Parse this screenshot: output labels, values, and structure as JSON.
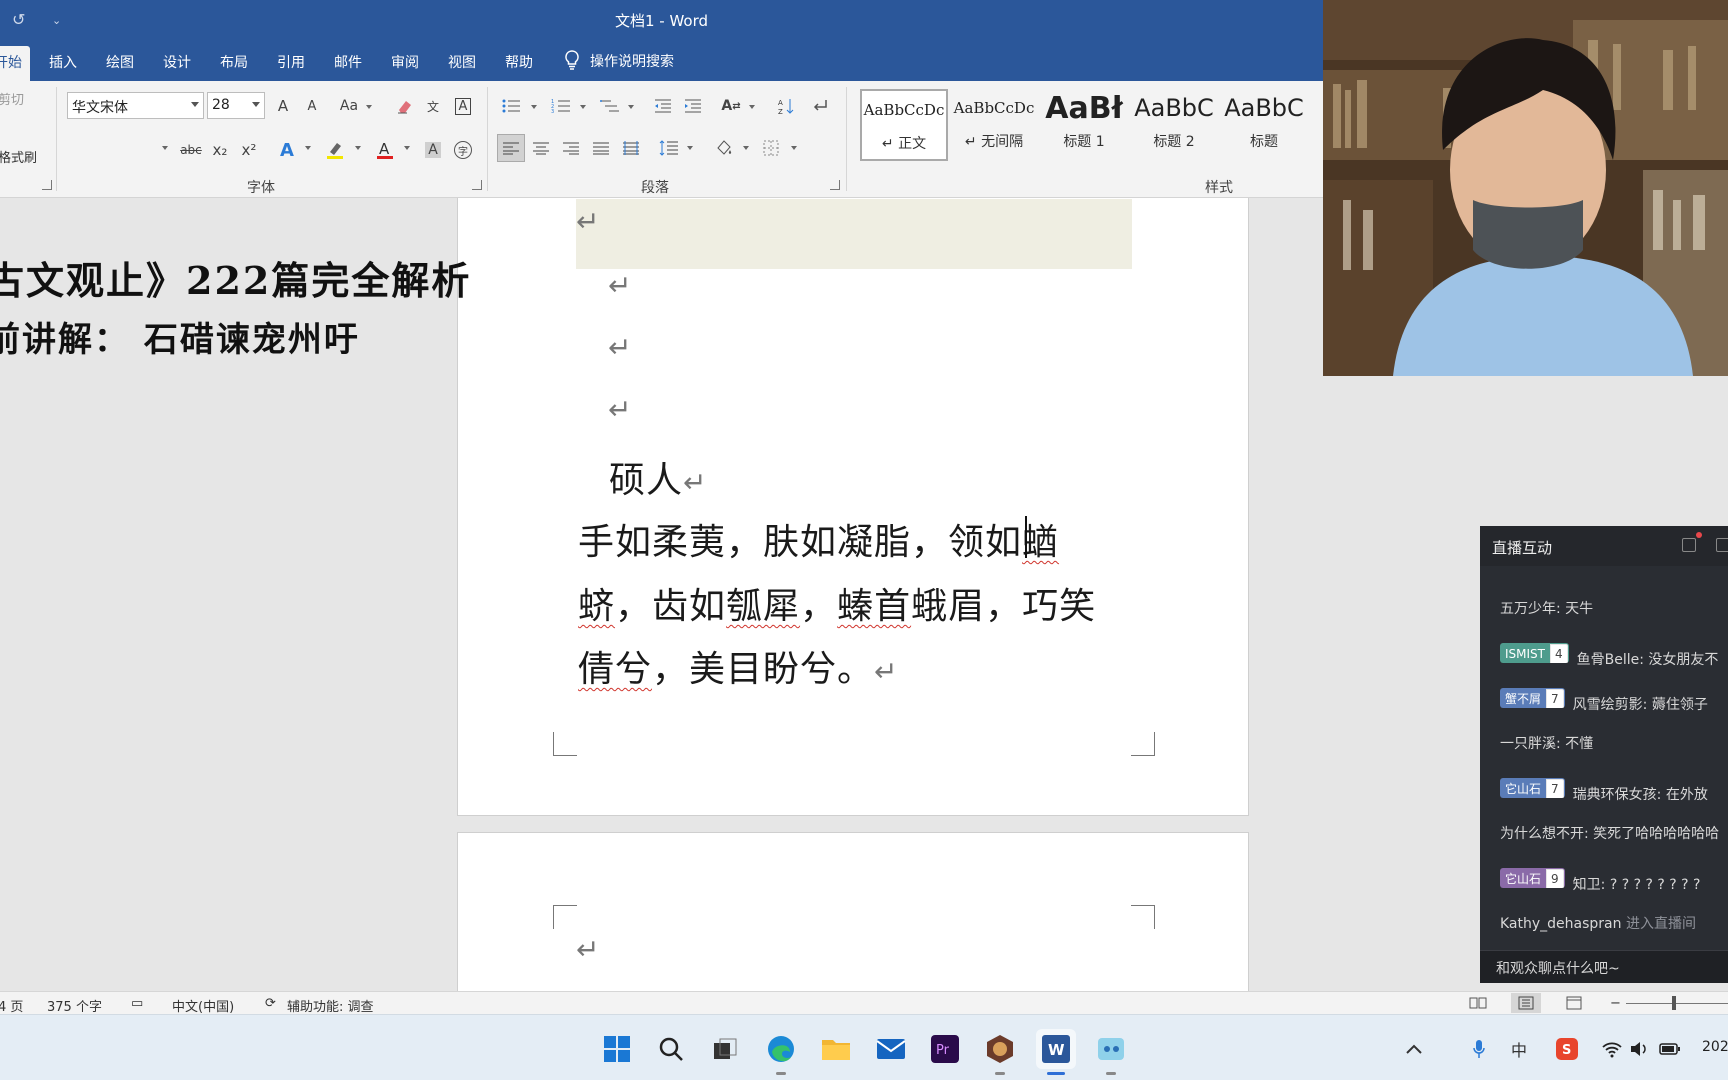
{
  "window": {
    "title": "文档1  -  Word"
  },
  "quick_access": {
    "undo_icon": "↺",
    "customize_icon": "⌄"
  },
  "ribbon_tabs": [
    {
      "label": "开始",
      "active": true
    },
    {
      "label": "插入"
    },
    {
      "label": "绘图"
    },
    {
      "label": "设计"
    },
    {
      "label": "布局"
    },
    {
      "label": "引用"
    },
    {
      "label": "邮件"
    },
    {
      "label": "审阅"
    },
    {
      "label": "视图"
    },
    {
      "label": "帮助"
    }
  ],
  "tell_me": {
    "label": "操作说明搜索"
  },
  "clipboard": {
    "cut_label": "剪切",
    "format_painter_label": "格式刷"
  },
  "font": {
    "name": "华文宋体",
    "size": "28",
    "grow": "A",
    "shrink": "A",
    "change_case": "Aa",
    "strike": "abc",
    "subscript": "x₂",
    "superscript": "x²",
    "group_label": "字体"
  },
  "paragraph": {
    "group_label": "段落"
  },
  "styles": {
    "group_label": "样式",
    "items": [
      {
        "sample": "AaBbCcDc",
        "name": "↵ 正文"
      },
      {
        "sample": "AaBbCcDc",
        "name": "↵ 无间隔"
      },
      {
        "sample": "AaBł",
        "name": "标题 1"
      },
      {
        "sample": "AaBbC",
        "name": "标题 2"
      },
      {
        "sample": "AaBbC",
        "name": "标题"
      }
    ]
  },
  "overlay": {
    "line1": "古文观止》222篇完全解析",
    "line2": "前讲解： 石碏谏宠州吁"
  },
  "document": {
    "para_mark": "↵",
    "title": "硕人",
    "lines": [
      {
        "before": "手如柔荑，肤如凝脂，领如",
        "error": "蝤"
      },
      {
        "error": "蛴",
        "mid1": "，齿如",
        "error2": "瓠犀",
        "mid2": "，",
        "error3": "螓首",
        "after": "蛾眉，巧笑"
      },
      {
        "error": "倩兮",
        "after": "，美目盼兮。"
      }
    ]
  },
  "status": {
    "page": "4 页",
    "words": "375 个字",
    "language": "中文(中国)",
    "accessibility": "辅助功能: 调查",
    "zoom_minus": "−",
    "zoom_plus": "+"
  },
  "taskbar": {
    "apps": [
      {
        "name": "start"
      },
      {
        "name": "search"
      },
      {
        "name": "task-view"
      },
      {
        "name": "edge"
      },
      {
        "name": "file-explorer"
      },
      {
        "name": "mail"
      },
      {
        "name": "premiere"
      },
      {
        "name": "obs"
      },
      {
        "name": "word"
      },
      {
        "name": "live-app"
      }
    ],
    "clock": "202"
  },
  "chat": {
    "title": "直播互动",
    "messages": [
      {
        "text": "五万少年: 天牛"
      },
      {
        "badge": "ISMIST",
        "level": "4",
        "color": "#4e9c8d",
        "text": "鱼骨Belle: 没女朋友不"
      },
      {
        "badge": "蟹不屑",
        "level": "7",
        "color": "#5a7cb8",
        "text": "风雪绘剪影: 薅住领子"
      },
      {
        "text": "一只胖溪: 不懂"
      },
      {
        "badge": "它山石",
        "level": "7",
        "color": "#5a7cb8",
        "text": "瑞典环保女孩: 在外放"
      },
      {
        "text": "为什么想不开: 笑死了哈哈哈哈哈哈"
      },
      {
        "badge": "它山石",
        "level": "9",
        "color": "#8a6aa8",
        "text": "知卫: ? ? ? ? ? ? ? ?"
      },
      {
        "text": "Kathy_dehaspran",
        "suffix": "进入直播间"
      }
    ],
    "input_placeholder": "和观众聊点什么吧~"
  },
  "colors": {
    "word_blue": "#2b579a",
    "chat_bg": "#2a2d33",
    "spell_error": "#d0342c"
  }
}
